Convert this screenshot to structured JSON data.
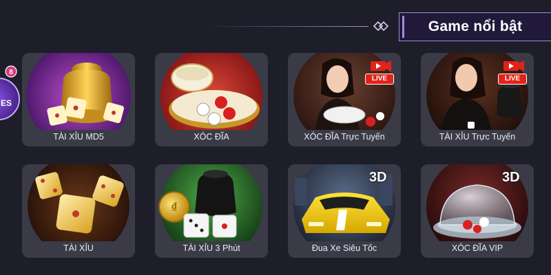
{
  "header": {
    "title": "Game nổi bật"
  },
  "side_badge": {
    "count": "8",
    "partial_text": "ES"
  },
  "games": [
    {
      "label": "TÀI XỈU MD5"
    },
    {
      "label": "XÓC ĐĨA"
    },
    {
      "label": "XÓC ĐĨA Trực Tuyến",
      "badge": "LIVE"
    },
    {
      "label": "TÀI XỈU Trực Tuyến",
      "badge": "LIVE"
    },
    {
      "label": "TÀI XỈU"
    },
    {
      "label": "TÀI XỈU 3 Phút"
    },
    {
      "label": "Đua Xe Siêu Tốc",
      "badge": "3D"
    },
    {
      "label": "XÓC ĐĨA VIP",
      "badge": "3D"
    }
  ],
  "colors": {
    "background": "#1d1e2a",
    "card": "#3a3b47",
    "banner_border": "#a48bd8",
    "live_red": "#e2231a",
    "gold": "#e8b422"
  }
}
